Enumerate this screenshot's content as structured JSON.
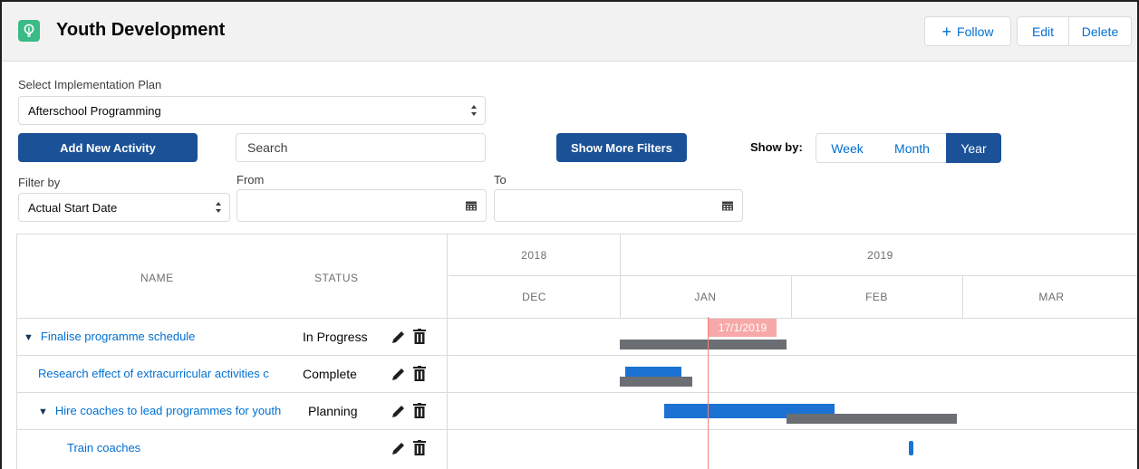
{
  "header": {
    "title": "Youth Development",
    "follow_label": "Follow",
    "edit_label": "Edit",
    "delete_label": "Delete"
  },
  "form": {
    "plan_label": "Select Implementation Plan",
    "plan_value": "Afterschool Programming",
    "add_activity_label": "Add New Activity",
    "search_placeholder": "Search",
    "show_more_filters_label": "Show More Filters",
    "show_by_label": "Show by:",
    "show_by_options": [
      "Week",
      "Month",
      "Year"
    ],
    "show_by_selected": "Year",
    "filter_by_label": "Filter by",
    "filter_by_value": "Actual Start Date",
    "from_label": "From",
    "to_label": "To",
    "from_value": "",
    "to_value": ""
  },
  "grid": {
    "columns": {
      "name": "NAME",
      "status": "STATUS"
    },
    "timeline": {
      "years": [
        "2018",
        "2019"
      ],
      "months": [
        "DEC",
        "JAN",
        "FEB",
        "MAR"
      ],
      "today_label": "17/1/2019"
    },
    "rows": [
      {
        "name": "Finalise programme schedule",
        "status": "In Progress",
        "expanded": true
      },
      {
        "name": "Research effect of extracurricular activities c",
        "status": "Complete"
      },
      {
        "name": "Hire coaches to lead programmes for youth",
        "status": "Planning",
        "expanded": true
      },
      {
        "name": "Train coaches",
        "status": ""
      }
    ]
  },
  "colors": {
    "brand": "#1b5297",
    "link": "#0070d2",
    "bar_actual": "#1b72d2",
    "bar_planned": "#6b6e73",
    "today_marker": "#f08080"
  }
}
